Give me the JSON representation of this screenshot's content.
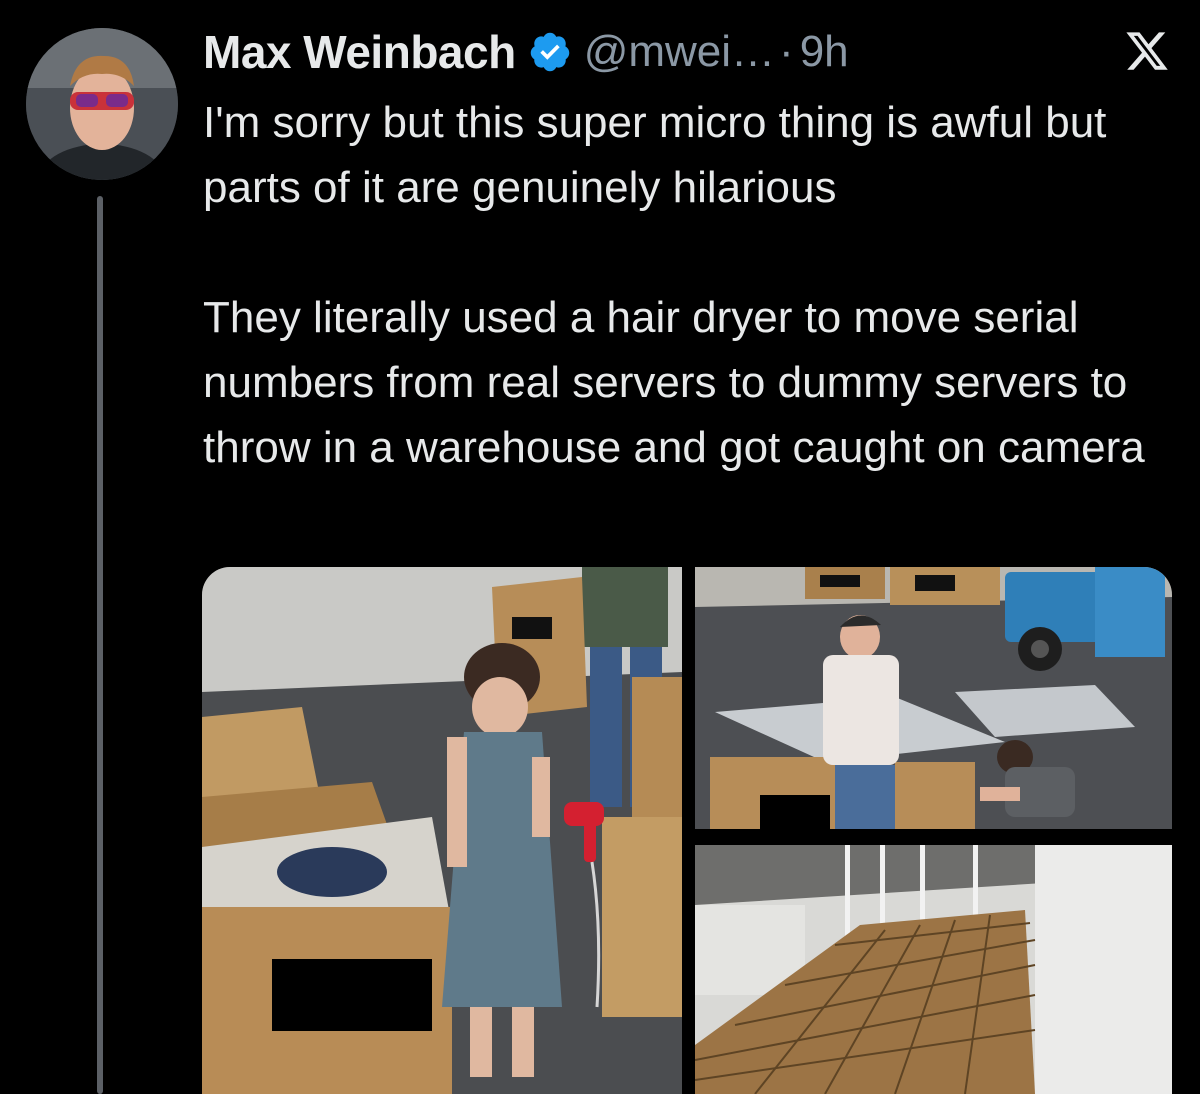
{
  "author": {
    "name": "Max Weinbach",
    "handle": "@mwei…",
    "separator": "·",
    "time": "9h",
    "verified": true
  },
  "icons": {
    "verified": "verified-badge-icon",
    "platform": "x-logo-icon"
  },
  "tweet": {
    "paragraph_1": "I'm sorry but this super micro thing is awful but parts of it are genuinely hilarious",
    "paragraph_2": "They literally used a hair dryer to move serial numbers from real servers to dummy servers to throw in a warehouse and got caught on camera"
  },
  "media": [
    {
      "kind": "photo",
      "subject": "woman using hair dryer over server boxes in warehouse"
    },
    {
      "kind": "photo",
      "subject": "workers at server boxes next to forklift"
    },
    {
      "kind": "photo",
      "subject": "warehouse filled with rows of boxes"
    }
  ],
  "colors": {
    "background": "#000000",
    "text": "#e7e9ea",
    "secondary": "#8b98a5",
    "verified": "#1d9bf0",
    "thread_line": "#5c6066"
  }
}
